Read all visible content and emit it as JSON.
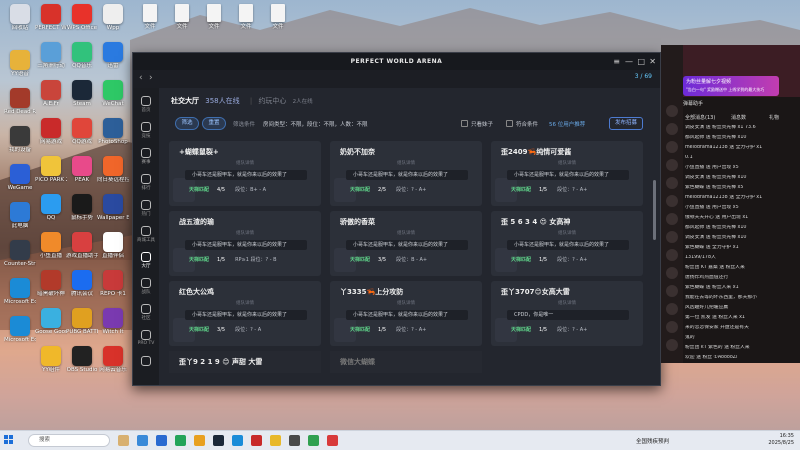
{
  "desktop": {
    "col1": [
      {
        "label": "回收站",
        "color": "#d9dde6"
      },
      {
        "label": "YY语音",
        "color": "#e7b23a"
      },
      {
        "label": "Red Dead Redemption 2",
        "color": "#a33a2a"
      },
      {
        "label": "我的设备",
        "color": "#3a3a3a"
      },
      {
        "label": "WeGame",
        "color": "#2b5fd6"
      },
      {
        "label": "此电脑",
        "color": "#2d7ad6"
      },
      {
        "label": "Counter-Strike 2",
        "color": "#333c4a"
      },
      {
        "label": "Microsoft Edge (2)",
        "color": "#1b8bd6"
      },
      {
        "label": "Microsoft Edge",
        "color": "#1b8bd6"
      }
    ],
    "col2": [
      {
        "label": "PERFECT WORLD",
        "color": "#d8322a"
      },
      {
        "label": "三角洲行动",
        "color": "#5a9fd8"
      },
      {
        "label": "A.E.Fr",
        "color": "#c9453b"
      },
      {
        "label": "网易游戏",
        "color": "#c92a2a"
      },
      {
        "label": "PICO PARK 2",
        "color": "#f0c43a"
      },
      {
        "label": "QQ",
        "color": "#2b9cf0"
      },
      {
        "label": "小鱼直播",
        "color": "#f08a2a"
      },
      {
        "label": "暗黑破坏神",
        "color": "#b23a2a"
      },
      {
        "label": "Goose Goose Duck",
        "color": "#3ab0e0"
      },
      {
        "label": "YY组件",
        "color": "#f0b82a"
      }
    ],
    "col3": [
      {
        "label": "WPS Office",
        "color": "#e8322a"
      },
      {
        "label": "QQ音乐",
        "color": "#31c27c"
      },
      {
        "label": "Steam",
        "color": "#1b2838"
      },
      {
        "label": "QQ游戏",
        "color": "#e0463a"
      },
      {
        "label": "PEAK",
        "color": "#e84a8a"
      },
      {
        "label": "鼠标手势",
        "color": "#1a1a1a"
      },
      {
        "label": "游戏直播助手",
        "color": "#d84040"
      },
      {
        "label": "腾讯会议",
        "color": "#1b6cf0"
      },
      {
        "label": "PUBG BATTLEGR...",
        "color": "#e0a020"
      },
      {
        "label": "OBS Studio",
        "color": "#222"
      }
    ],
    "col4": [
      {
        "label": "Wpp",
        "color": "#eee"
      },
      {
        "label": "迅雷",
        "color": "#2a7ae0"
      },
      {
        "label": "WeChat",
        "color": "#2ec866"
      },
      {
        "label": "PhotoShop",
        "color": "#2d5f99"
      },
      {
        "label": "向日葵远程控制",
        "color": "#f0662a"
      },
      {
        "label": "Wallpaper Engine",
        "color": "#2a4aa0"
      },
      {
        "label": "直播伴侣",
        "color": "#fff"
      },
      {
        "label": "REPO 卡1",
        "color": "#c83a3a"
      },
      {
        "label": "Witch It",
        "color": "#7a3ab0"
      },
      {
        "label": "网易云音乐",
        "color": "#d8322a"
      }
    ]
  },
  "files": [
    "文件",
    "文件",
    "文件",
    "文件",
    "文件"
  ],
  "app": {
    "title": "PERFECT WORLD ARENA",
    "counter": "3 / 69",
    "sidebar": [
      {
        "label": "首页",
        "icon": "home-icon"
      },
      {
        "label": "竞技",
        "icon": "target-icon"
      },
      {
        "label": "赛事",
        "icon": "trophy-icon"
      },
      {
        "label": "排行",
        "icon": "chart-icon"
      },
      {
        "label": "热门",
        "icon": "fire-icon"
      },
      {
        "label": "商城工具",
        "icon": "tools-icon"
      },
      {
        "label": "大厅",
        "icon": "lobby-icon"
      },
      {
        "label": "战队",
        "icon": "team-icon"
      },
      {
        "label": "社区",
        "icon": "community-icon"
      },
      {
        "label": "PRO TV",
        "icon": "tv-icon"
      },
      {
        "label": "",
        "icon": "vip-icon"
      }
    ],
    "tabs": {
      "social": "社交大厅",
      "social_count": "358人在线",
      "team": "约玩中心",
      "team_count": "2人在线"
    },
    "filter": {
      "filter_btn": "筛选",
      "reset_btn": "重置",
      "conditions_label": "筛选条件",
      "conditions": "房间类型：不限，段位：不限，人数：不限",
      "only_me": "只看妹子",
      "match": "符合条件",
      "count": "56 位用户推荐",
      "publish": "发布招募"
    },
    "cards": [
      {
        "name": "+蝴蝶鼠裂+",
        "sub": "组队详情",
        "msg": "小哥车还是服甲车，就是你来以后的效果了",
        "mode": "天梯匹配",
        "cap": "4/5",
        "rank": "段位：B+ - A"
      },
      {
        "name": "奶奶不加奈",
        "sub": "组队详情",
        "msg": "小哥车还是服甲车，就是你来以后的效果了",
        "mode": "天梯匹配",
        "cap": "2/5",
        "rank": "段位：? - A+"
      },
      {
        "name": "歪2409🦐纯情可爱酱",
        "sub": "组队详情",
        "msg": "小哥车还是服甲车，就是你来以后的效果了",
        "mode": "天梯匹配",
        "cap": "1/5",
        "rank": "段位：? - A+"
      },
      {
        "name": "战五渣的瑜",
        "sub": "组队详情",
        "msg": "小哥车还是服甲车，就是你来以后的效果了",
        "mode": "天梯匹配",
        "cap": "1/5",
        "rank": "RP≥1    段位：? - B"
      },
      {
        "name": "骄傲的香菜",
        "sub": "组队详情",
        "msg": "小哥车还是服甲车，就是你来以后的效果了",
        "mode": "天梯匹配",
        "cap": "3/5",
        "rank": "段位：B - A+"
      },
      {
        "name": "歪 5 6 3 4 😍 女高神",
        "sub": "组队详情",
        "msg": "小哥车还是服甲车，就是你来以后的效果了",
        "mode": "天梯匹配",
        "cap": "1/5",
        "rank": "段位：? - A+"
      },
      {
        "name": "红色大公鸡",
        "sub": "组队详情",
        "msg": "小哥车还是服甲车，就是你来以后的效果了",
        "mode": "天梯匹配",
        "cap": "3/5",
        "rank": "段位：? - A"
      },
      {
        "name": "丫3335🦐上分攻防",
        "sub": "组队详情",
        "msg": "小哥车还是服甲车，就是你来以后的效果了",
        "mode": "天梯匹配",
        "cap": "1/5",
        "rank": "段位：? - A+"
      },
      {
        "name": "歪丫3707😊女高大雷",
        "sub": "组队详情",
        "msg": "CPDD，你是唯一",
        "mode": "天梯匹配",
        "cap": "1/5",
        "rank": "段位：? - A+"
      }
    ],
    "partial": [
      "歪丫9 2 1 9 😊 声甜 大雷",
      "微信大蝴蝶"
    ]
  },
  "live": {
    "adv": "为粉丝量解七夕视频",
    "adv2": "\"告白一句\" 奖励赠送中 上线学到的最大技巧",
    "sub": "弹幕助手",
    "tabs": [
      "全部消息(13)",
      "消息数",
      "礼物"
    ],
    "rows": [
      "调皮女演 送 粉丝荧光棒 x1 73.6",
      "都风起帅 送 粉丝荧光棒 x10",
      "melodrama12138 送 全力守护 x1",
      "0.1",
      "小鱼直播 送 用户出现 x5",
      "调皮女演 送 粉丝荧光棒 x10",
      "紫色蝴蝶 送 粉丝荧光棒 x5",
      "melodrama12138 送 全力守护 x1",
      "小鱼直播 送 用户出现 x5",
      "俄顿天天开心 送 用户出现 x1",
      "都风起帅 送 粉丝荧光棒 x10",
      "调皮女演 送 粉丝荧光棒 x10",
      "紫色蝴蝶 送 全力守护 x1",
      "13199/178人",
      "粉丝团 KT 嘉桑 送 粉丝人来",
      "唐扬炸鸡热血值还行",
      "紫色蝴蝶 送 粉丝人来 x1",
      "我能在去等的坏东西里，那天那小",
      "风凶趣好几把暖应赢",
      "第一位 凯发 送 粉丝人来 x1",
      "米的恋恋保安家 开盘还是有天",
      "鬼的",
      "粉丝团 kT 紫色的 送 粉丝人来",
      "欢迎 送 粉丝 ①AooooZi"
    ]
  },
  "taskbar": {
    "search": "搜索",
    "lang": "全国残疾预判",
    "time": "16:35",
    "date": "2025/8/25",
    "badge": "11:1 NF"
  }
}
